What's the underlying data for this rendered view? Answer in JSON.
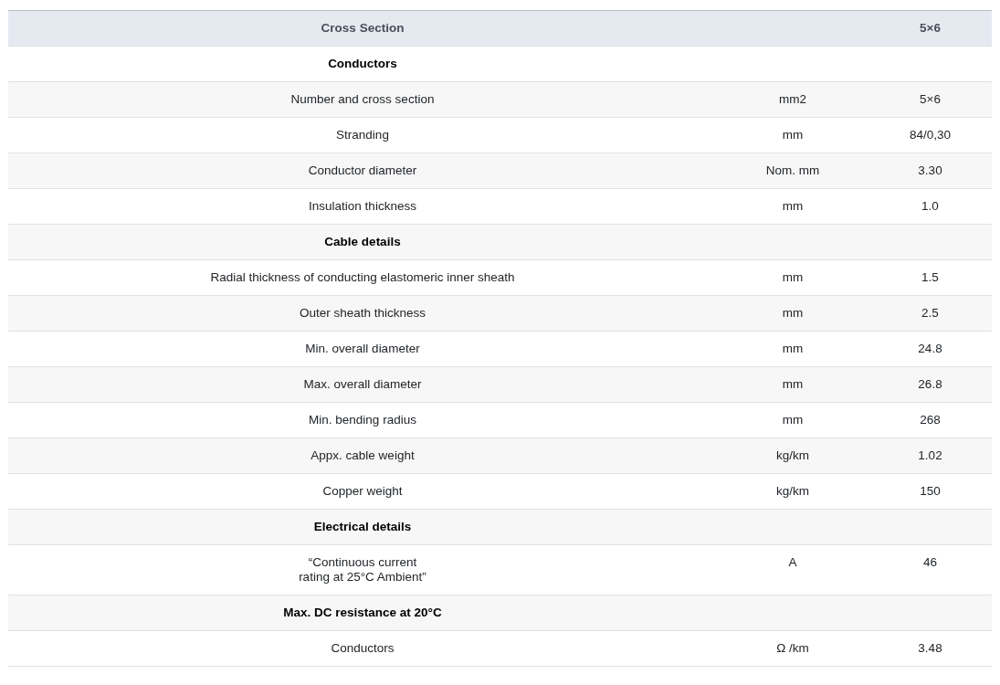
{
  "table": {
    "header": {
      "label": "Cross Section",
      "value": "5×6"
    },
    "rows": [
      {
        "kind": "section",
        "label": "Conductors"
      },
      {
        "kind": "data",
        "label": "Number and cross section",
        "unit": "mm2",
        "value": "5×6"
      },
      {
        "kind": "data",
        "label": "Stranding",
        "unit": "mm",
        "value": "84/0,30"
      },
      {
        "kind": "data",
        "label": "Conductor diameter",
        "unit": "Nom. mm",
        "value": "3.30"
      },
      {
        "kind": "data",
        "label": "Insulation thickness",
        "unit": "mm",
        "value": "1.0"
      },
      {
        "kind": "section",
        "label": "Cable details"
      },
      {
        "kind": "data",
        "label": "Radial thickness of conducting elastomeric inner sheath",
        "unit": "mm",
        "value": "1.5"
      },
      {
        "kind": "data",
        "label": "Outer sheath thickness",
        "unit": "mm",
        "value": "2.5"
      },
      {
        "kind": "data",
        "label": "Min. overall diameter",
        "unit": "mm",
        "value": "24.8"
      },
      {
        "kind": "data",
        "label": "Max. overall diameter",
        "unit": "mm",
        "value": "26.8"
      },
      {
        "kind": "data",
        "label": "Min. bending radius",
        "unit": "mm",
        "value": "268"
      },
      {
        "kind": "data",
        "label": "Appx. cable weight",
        "unit": "kg/km",
        "value": "1.02"
      },
      {
        "kind": "data",
        "label": "Copper weight",
        "unit": "kg/km",
        "value": "150"
      },
      {
        "kind": "section",
        "label": "Electrical details"
      },
      {
        "kind": "data",
        "label": "“Continuous current\nrating at 25°C Ambient”",
        "unit": "A",
        "value": "46"
      },
      {
        "kind": "section",
        "label": "Max. DC resistance at 20°C"
      },
      {
        "kind": "data",
        "label": "Conductors",
        "unit": "Ω /km",
        "value": "3.48"
      }
    ]
  }
}
